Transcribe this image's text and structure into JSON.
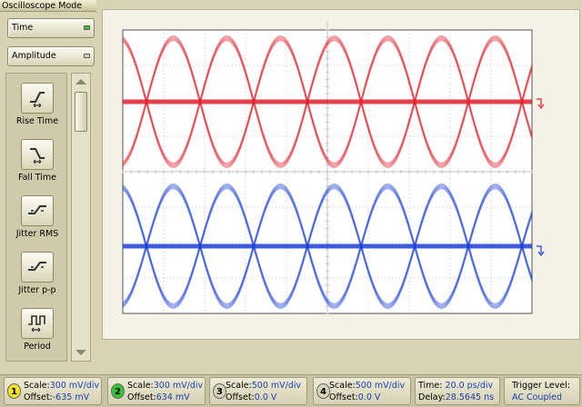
{
  "window": {
    "title": "Oscilloscope Mode"
  },
  "modes": {
    "time": {
      "label": "Time",
      "led_color": "#3cc83c"
    },
    "amplitude": {
      "label": "Amplitude",
      "led_color": "#d8d4b8"
    }
  },
  "measurements": [
    {
      "label": "Rise Time",
      "icon": "rise-time-icon"
    },
    {
      "label": "Fall Time",
      "icon": "fall-time-icon"
    },
    {
      "label": "Jitter RMS",
      "icon": "jitter-rms-icon"
    },
    {
      "label": "Jitter p-p",
      "icon": "jitter-pp-icon"
    },
    {
      "label": "Period",
      "icon": "period-icon"
    }
  ],
  "channels": [
    {
      "number": "1",
      "badge_color": "#f2e22a",
      "scale_label": "Scale:",
      "scale_value": "300 mV/div",
      "offset_label": "Offset:",
      "offset_value": "-635 mV"
    },
    {
      "number": "2",
      "badge_color": "#36c436",
      "scale_label": "Scale:",
      "scale_value": "300 mV/div",
      "offset_label": "Offset:",
      "offset_value": "634 mV"
    },
    {
      "number": "3",
      "badge_color": "#d8d4b8",
      "scale_label": "Scale:",
      "scale_value": "500 mV/div",
      "offset_label": "Offset:",
      "offset_value": "0.0 V"
    },
    {
      "number": "4",
      "badge_color": "#d8d4b8",
      "scale_label": "Scale:",
      "scale_value": "500 mV/div",
      "offset_label": "Offset:",
      "offset_value": "0.0 V"
    }
  ],
  "timebase": {
    "time_label": "Time:",
    "time_value": "20.0 ps/div",
    "delay_label": "Delay:",
    "delay_value": "28.5645 ns"
  },
  "trigger": {
    "label": "Trigger Level:",
    "value": "AC Coupled"
  },
  "colors": {
    "trace_red": "#e0202a",
    "trace_blue": "#1a3fd6",
    "grid": "#b8b8b8"
  },
  "chart_data": {
    "type": "eye-diagram",
    "grid": {
      "x_divisions": 10,
      "y_divisions": 8
    },
    "series": [
      {
        "channel": "1",
        "color": "#e0202a"
      },
      {
        "channel": "2",
        "color": "#1a3fd6"
      }
    ]
  }
}
